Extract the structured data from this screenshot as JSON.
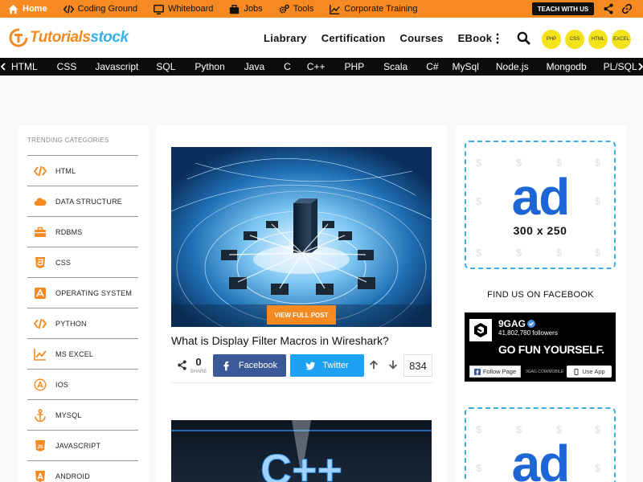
{
  "topbar": {
    "links": [
      "Home",
      "Coding Ground",
      "Whiteboard",
      "Jobs",
      "Tools",
      "Corporate Training"
    ],
    "teach_label": "TEACH WITH US"
  },
  "header": {
    "logo_main": "Tutorials",
    "logo_accent": "stock",
    "nav": [
      "Liabrary",
      "Certification",
      "Courses",
      "EBook"
    ],
    "quick_links": [
      "PHP",
      "CSS",
      "HTML",
      "EXCEL"
    ]
  },
  "category_bar": [
    "HTML",
    "CSS",
    "Javascript",
    "SQL",
    "Python",
    "Java",
    "C",
    "C++",
    "PHP",
    "Scala",
    "C#",
    "MySql",
    "Node.js",
    "Mongodb",
    "PL/SQL"
  ],
  "sidebar": {
    "title": "TRENDING CATEGORIES",
    "items": [
      {
        "label": "HTML",
        "icon": "code-icon"
      },
      {
        "label": "DATA STRUCTURE",
        "icon": "cloud-icon"
      },
      {
        "label": "RDBMS",
        "icon": "briefcase-icon"
      },
      {
        "label": "CSS",
        "icon": "css3-icon"
      },
      {
        "label": "OPERATING SYSTEM",
        "icon": "app-store-icon"
      },
      {
        "label": "PYTHON",
        "icon": "code-icon"
      },
      {
        "label": "MS EXCEL",
        "icon": "line-chart-icon"
      },
      {
        "label": "IOS",
        "icon": "app-store-circle-icon"
      },
      {
        "label": "MYSQL",
        "icon": "anchor-icon"
      },
      {
        "label": "JAVASCRIPT",
        "icon": "js-icon"
      },
      {
        "label": "ANDROID",
        "icon": "android-icon"
      }
    ]
  },
  "post": {
    "view_label": "VIEW FULL POST",
    "title": "What is Display Filter Macros in Wireshark?",
    "share_count": "0",
    "share_label": "SHARE",
    "facebook_label": "Facebook",
    "twitter_label": "Twitter",
    "vote_count": "834"
  },
  "post2": {
    "image_text": "C++"
  },
  "ads": {
    "word": "ad",
    "size": "300 x 250"
  },
  "facebook": {
    "heading": "FIND US ON FACEBOOK",
    "page_name": "9GAG",
    "followers": "41,802,780 followers",
    "slogan": "GO FUN YOURSELF.",
    "follow_label": "Follow Page",
    "site": "9GAG.COM/MOBILE",
    "use_app": "Use App"
  },
  "colors": {
    "brand_orange": "#f58a23",
    "brand_blue": "#3ab0e6",
    "facebook": "#3b5998",
    "twitter": "#1da1f2",
    "quick_link_yellow": "#f4e31a",
    "ad_blue": "#1d66d4"
  }
}
